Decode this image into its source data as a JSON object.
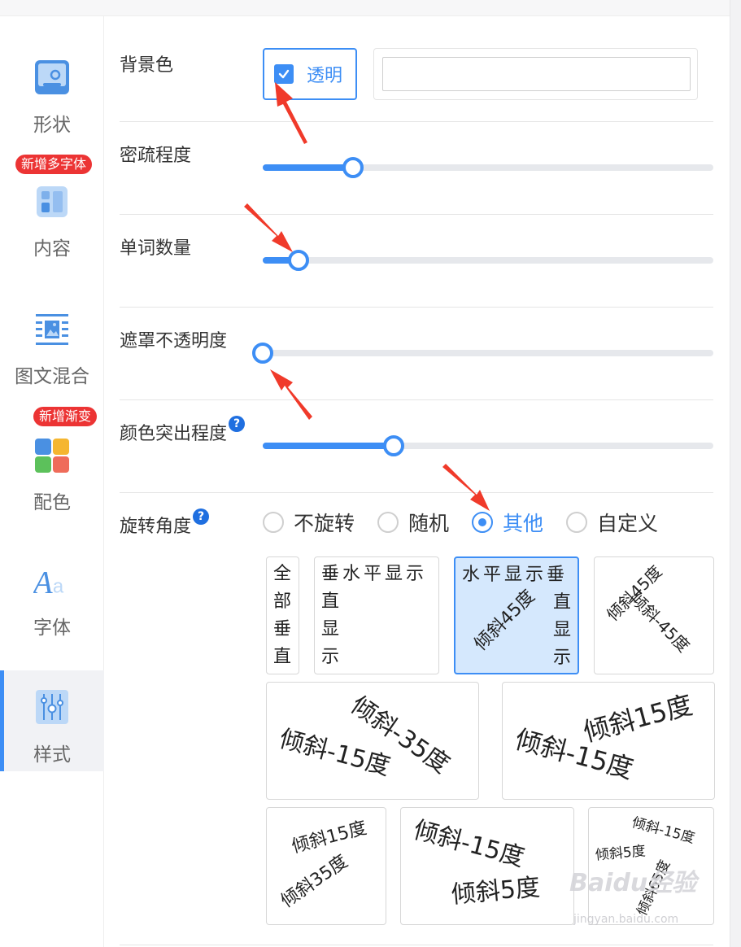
{
  "sidebar": {
    "items": [
      {
        "label": "形状"
      },
      {
        "label": "内容",
        "badge": "新增多字体"
      },
      {
        "label": "图文混合"
      },
      {
        "label": "配色",
        "badge": "新增渐变"
      },
      {
        "label": "字体"
      },
      {
        "label": "样式"
      }
    ],
    "active": "样式",
    "accent_color": "#3d8ef5",
    "badge_color": "#ec3434"
  },
  "background": {
    "label": "背景色",
    "transparent_checkbox_label": "透明",
    "transparent_checked": true,
    "color_value": ""
  },
  "sliders": [
    {
      "label": "密疏程度",
      "value_fraction": 0.2
    },
    {
      "label": "单词数量",
      "value_fraction": 0.08
    },
    {
      "label": "遮罩不透明度",
      "value_fraction": 0.0
    },
    {
      "label": "颜色突出程度",
      "value_fraction": 0.29,
      "help": "?"
    }
  ],
  "rotation": {
    "label": "旋转角度",
    "help": "?",
    "options": [
      "不旋转",
      "随机",
      "其他",
      "自定义"
    ],
    "selected": "其他",
    "presets": [
      {
        "words": [
          "全",
          "部",
          "垂",
          "直"
        ]
      },
      {
        "words": [
          "垂水平显示",
          "直",
          "显",
          "示"
        ]
      },
      {
        "words": [
          "水平显示垂",
          "倾斜45度",
          "直",
          "显",
          "示"
        ],
        "selected": true
      },
      {
        "words": [
          "倾斜45度",
          "倾斜-45度"
        ]
      },
      {
        "words": [
          "倾斜-35度",
          "倾斜-15度"
        ]
      },
      {
        "words": [
          "倾斜15度",
          "倾斜-15度"
        ]
      },
      {
        "words": [
          "倾斜15度",
          "倾斜35度"
        ]
      },
      {
        "words": [
          "倾斜-15度",
          "倾斜5度"
        ]
      },
      {
        "words": [
          "倾斜-15度",
          "倾斜5度",
          "倾斜65度"
        ]
      }
    ]
  },
  "watermark": {
    "text": "Baidu经验",
    "sub": "jingyan.baidu.com"
  }
}
